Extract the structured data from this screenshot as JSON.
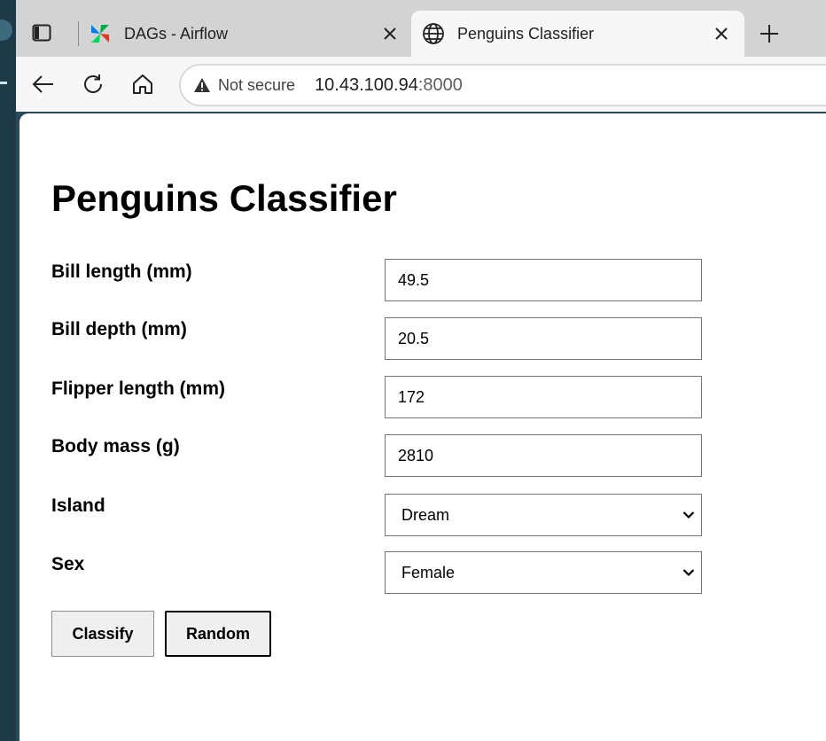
{
  "browser": {
    "tabs": [
      {
        "title": "DAGs - Airflow",
        "icon": "airflow-icon",
        "active": false
      },
      {
        "title": "Penguins Classifier",
        "icon": "globe-icon",
        "active": true
      }
    ],
    "address_bar": {
      "security_label": "Not secure",
      "url_host": "10.43.100.94",
      "url_port": ":8000"
    }
  },
  "page": {
    "heading": "Penguins Classifier",
    "fields": [
      {
        "label": "Bill length (mm)",
        "value": "49.5",
        "type": "number"
      },
      {
        "label": "Bill depth (mm)",
        "value": "20.5",
        "type": "number"
      },
      {
        "label": "Flipper length (mm)",
        "value": "172",
        "type": "number"
      },
      {
        "label": "Body mass (g)",
        "value": "2810",
        "type": "number"
      },
      {
        "label": "Island",
        "value": "Dream",
        "type": "select"
      },
      {
        "label": "Sex",
        "value": "Female",
        "type": "select"
      }
    ],
    "buttons": {
      "classify": "Classify",
      "random": "Random"
    }
  }
}
